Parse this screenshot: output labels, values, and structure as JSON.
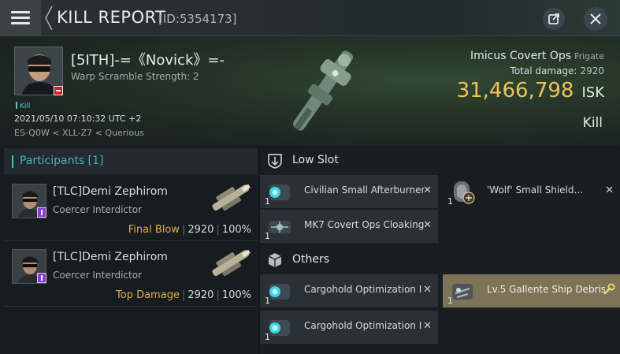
{
  "titlebar": {
    "title": "KILL REPORT",
    "report_id": "[ID:5354173]",
    "icons": [
      "menu-icon",
      "share-icon",
      "close-icon"
    ]
  },
  "victim": {
    "name": "[5ITH]-=《Novick》=-",
    "warp_scramble": "Warp Scramble Strength: 2",
    "kill_tag": "Kill",
    "datetime": "2021/05/10 07:10:32 UTC +2",
    "location": "ES-Q0W < XLL-Z7 < Querious"
  },
  "ship": {
    "name": "Imicus Covert Ops",
    "class": "Frigate",
    "damage_label": "Total damage:",
    "damage_value": "2920",
    "isk_value": "31,466,798",
    "isk_unit": "ISK",
    "result": "Kill"
  },
  "participants": {
    "title": "Participants [1]",
    "rows": [
      {
        "name": "[TLC]Demi Zephirom",
        "ship": "Coercer Interdictor",
        "role": "Final Blow",
        "damage": "2920",
        "percent": "100%"
      },
      {
        "name": "[TLC]Demi Zephirom",
        "ship": "Coercer Interdictor",
        "role": "Top Damage",
        "damage": "2920",
        "percent": "100%"
      }
    ]
  },
  "fitting": {
    "low_slot": {
      "title": "Low Slot",
      "items": [
        {
          "name": "Civilian Small Afterburner",
          "qty": "1",
          "close": "✕"
        },
        {
          "name": "'Wolf' Small Shield...",
          "qty": "1",
          "close": "✕"
        },
        {
          "name": "MK7 Covert Ops Cloaking...",
          "qty": "1",
          "close": "✕"
        }
      ]
    },
    "others": {
      "title": "Others",
      "items": [
        {
          "name": "Cargohold Optimization I",
          "qty": "1",
          "close": "✕"
        },
        {
          "name": "Lv.5 Gallente Ship Debris",
          "qty": "1"
        },
        {
          "name": "Cargohold Optimization I",
          "qty": "1",
          "close": "✕"
        }
      ]
    }
  },
  "colors": {
    "isk": "#f0c35a",
    "accent": "#4fb0b5",
    "role": "#e0ac4c",
    "drop_bg": "#7d7358"
  }
}
